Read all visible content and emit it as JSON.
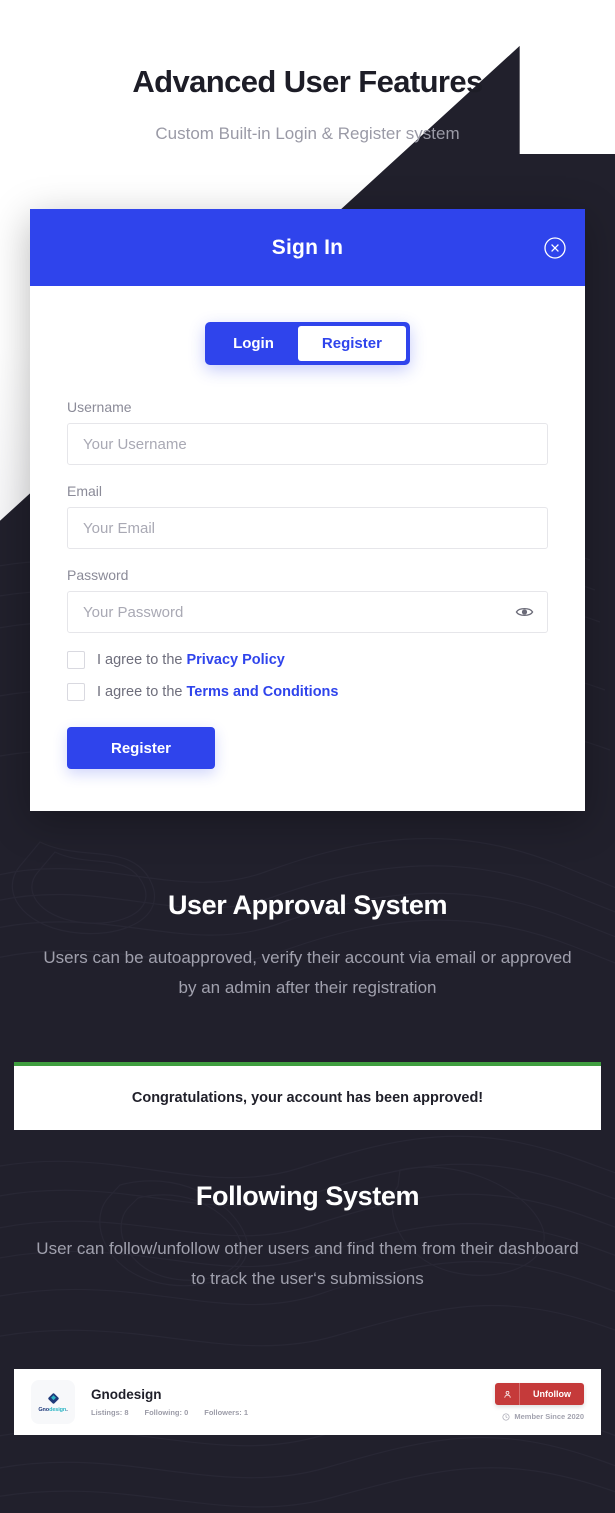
{
  "hero": {
    "title": "Advanced User Features",
    "subtitle": "Custom Built-in Login & Register system"
  },
  "modal": {
    "title": "Sign In",
    "close_icon": "close-circle-icon",
    "tabs": [
      {
        "label": "Login",
        "active": false
      },
      {
        "label": "Register",
        "active": true
      }
    ],
    "fields": [
      {
        "label": "Username",
        "placeholder": "Your Username",
        "value": "",
        "type": "text"
      },
      {
        "label": "Email",
        "placeholder": "Your Email",
        "value": "",
        "type": "email"
      },
      {
        "label": "Password",
        "placeholder": "Your Password",
        "value": "",
        "type": "password",
        "trailing_icon": "eye-icon"
      }
    ],
    "agreements": [
      {
        "text": "I agree to the ",
        "link": "Privacy Policy",
        "checked": false
      },
      {
        "text": "I agree to the ",
        "link": "Terms and Conditions",
        "checked": false
      }
    ],
    "submit_label": "Register"
  },
  "approval_section": {
    "title": "User Approval System",
    "subtitle": "Users can be autoapproved, verify their account via email or approved by an admin after their registration",
    "banner_text": "Congratulations, your account has been approved!"
  },
  "following_section": {
    "title": "Following System",
    "subtitle": "User can follow/unfollow other users and find them from their dashboard to track the user‘s submissions"
  },
  "profile_card": {
    "avatar_wordmark": "Gnodesign.",
    "avatar_icon": "diamond-logo-icon",
    "name": "Gnodesign",
    "stats": [
      "Listings: 8",
      "Following: 0",
      "Followers: 1"
    ],
    "unfollow_label": "Unfollow",
    "unfollow_icon": "user-icon",
    "member_since": "Member Since 2020",
    "member_since_icon": "clock-icon"
  },
  "colors": {
    "accent_blue": "#2f44ec",
    "dark_bg": "#21202c",
    "approval_green": "#3f9e3f",
    "unfollow_red": "#c53a3a",
    "heading_dark": "#1d1d27",
    "muted_text": "#9a9aa6"
  }
}
